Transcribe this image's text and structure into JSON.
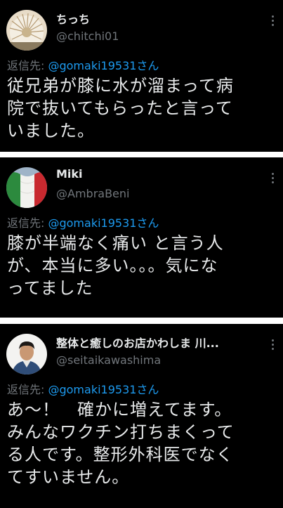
{
  "tweets": [
    {
      "name": "ちっち",
      "handle": "@chitchi01",
      "reply_prefix": "返信先: ",
      "reply_to": "@gomaki19531さん",
      "text_lines": [
        "従兄弟が膝に水が溜まって病",
        "院で抜いてもらったと言って",
        "いました。"
      ],
      "avatar": "decorative-fan-avatar"
    },
    {
      "name": "Miki",
      "handle": "@AmbraBeni",
      "reply_prefix": "返信先: ",
      "reply_to": "@gomaki19531さん",
      "text_lines": [
        "膝が半端なく痛い と言う人",
        "が、本当に多い。。。気にな",
        "ってました"
      ],
      "avatar": "italian-flag-avatar"
    },
    {
      "name": "整体と癒しのお店かわしま 川...",
      "handle": "@seitaikawashima",
      "reply_prefix": "返信先: ",
      "reply_to": "@gomaki19531さん",
      "text_lines": [
        "あ～！　確かに増えてます。",
        "みんなワクチン打ちまくって",
        "る人です。整形外科医でなく",
        "てすいません。"
      ],
      "avatar": "person-photo-avatar"
    }
  ],
  "colors": {
    "background": "#000000",
    "separator": "#ffffff",
    "text": "#e7e9ea",
    "secondary": "#71767b",
    "link": "#1d9bf0"
  }
}
